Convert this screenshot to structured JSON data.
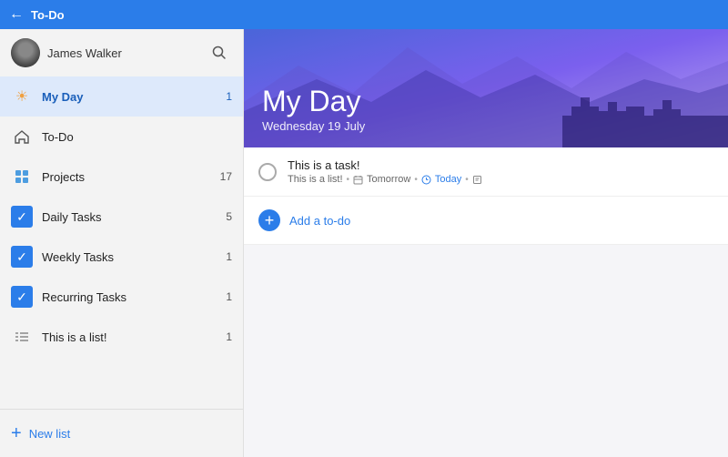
{
  "titleBar": {
    "back_icon": "←",
    "title": "To-Do"
  },
  "sidebar": {
    "user": {
      "name": "James Walker"
    },
    "search_icon": "🔍",
    "nav_items": [
      {
        "id": "my-day",
        "label": "My Day",
        "badge": "1",
        "active": true,
        "icon_type": "sun"
      },
      {
        "id": "to-do",
        "label": "To-Do",
        "badge": "",
        "active": false,
        "icon_type": "home"
      },
      {
        "id": "projects",
        "label": "Projects",
        "badge": "17",
        "active": false,
        "icon_type": "grid"
      },
      {
        "id": "daily-tasks",
        "label": "Daily Tasks",
        "badge": "5",
        "active": false,
        "icon_type": "check"
      },
      {
        "id": "weekly-tasks",
        "label": "Weekly Tasks",
        "badge": "1",
        "active": false,
        "icon_type": "check"
      },
      {
        "id": "recurring-tasks",
        "label": "Recurring Tasks",
        "badge": "1",
        "active": false,
        "icon_type": "check"
      },
      {
        "id": "this-is-a-list",
        "label": "This is a list!",
        "badge": "1",
        "active": false,
        "icon_type": "list"
      }
    ],
    "new_list_label": "New list"
  },
  "main": {
    "header": {
      "title": "My Day",
      "subtitle": "Wednesday 19 July"
    },
    "tasks": [
      {
        "id": "task-1",
        "title": "This is a task!",
        "list": "This is a list!",
        "due": "Tomorrow",
        "reminder": "Today",
        "has_note": true
      }
    ],
    "add_todo_label": "Add a to-do"
  }
}
